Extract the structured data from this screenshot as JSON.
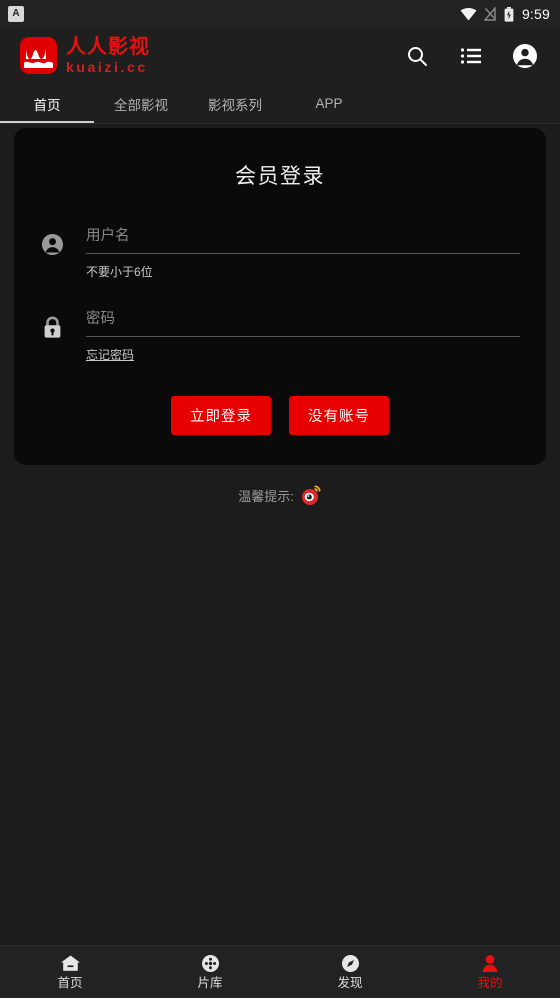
{
  "status_bar": {
    "app_badge": "A",
    "icons": [
      "wifi-icon",
      "signal-off-icon",
      "battery-charging-icon"
    ],
    "time": "9:59"
  },
  "header": {
    "logo_icon": "brand-wave-icon",
    "brand_title": "人人影视",
    "brand_subtitle": "kuaizi.cc",
    "actions": [
      {
        "name": "search-icon",
        "label": "搜索"
      },
      {
        "name": "list-icon",
        "label": "列表"
      },
      {
        "name": "account-icon",
        "label": "账户"
      }
    ]
  },
  "tabs": [
    {
      "label": "首页",
      "active": true
    },
    {
      "label": "全部影视",
      "active": false
    },
    {
      "label": "影视系列",
      "active": false
    },
    {
      "label": "APP",
      "active": false
    }
  ],
  "login": {
    "title": "会员登录",
    "username": {
      "icon": "person-icon",
      "value": "",
      "placeholder": "用户名",
      "hint": "不要小于6位"
    },
    "password": {
      "icon": "lock-icon",
      "value": "",
      "placeholder": "密码",
      "forgot_label": "忘记密码"
    },
    "submit_label": "立即登录",
    "register_label": "没有账号",
    "button_color": "#e60000"
  },
  "tip": {
    "text": "温馨提示:",
    "icon": "weibo-icon"
  },
  "bottom_nav": [
    {
      "label": "首页",
      "icon": "home-icon",
      "active": false
    },
    {
      "label": "片库",
      "icon": "film-reel-icon",
      "active": false
    },
    {
      "label": "发现",
      "icon": "compass-icon",
      "active": false
    },
    {
      "label": "我的",
      "icon": "person-icon",
      "active": true
    }
  ],
  "colors": {
    "page_background": "#1c1c1c",
    "card_background": "#0a0a0a",
    "brand_red": "#e81010",
    "accent_red": "#e60000"
  }
}
